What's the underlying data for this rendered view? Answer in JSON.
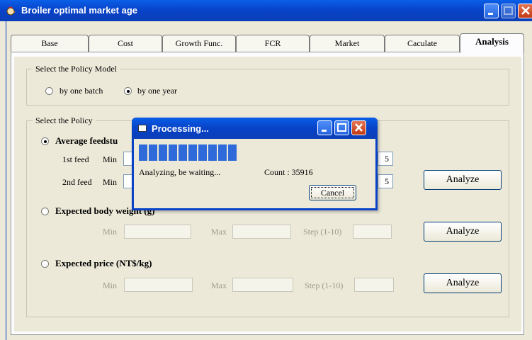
{
  "window": {
    "title": "Broiler optimal market age",
    "icon": "rooster-icon"
  },
  "tabs": [
    "Base",
    "Cost",
    "Growth Func.",
    "FCR",
    "Market",
    "Caculate",
    "Analysis"
  ],
  "active_tab": "Analysis",
  "policy_model": {
    "legend": "Select the Policy Model",
    "options": [
      "by one batch",
      "by one year"
    ],
    "selected": "by one year"
  },
  "policy": {
    "legend": "Select the Policy",
    "feed": {
      "label": "Average feedstu",
      "row1_label": "1st feed",
      "row2_label": "2nd feed",
      "min_label": "Min",
      "step_value_1": "5",
      "step_value_2": "5",
      "analyze": "Analyze"
    },
    "weight": {
      "label": "Expected body weight (g)",
      "min_label": "Min",
      "max_label": "Max",
      "step_label": "Step (1-10)",
      "analyze": "Analyze"
    },
    "price": {
      "label": "Expected price (NT$/kg)",
      "min_label": "Min",
      "max_label": "Max",
      "step_label": "Step (1-10)",
      "analyze": "Analyze"
    }
  },
  "dialog": {
    "title": "Processing...",
    "message": "Analyzing, be waiting...",
    "count_label": "Count : 35916",
    "cancel": "Cancel",
    "progress": 0.8
  },
  "colors": {
    "titlebar": "#0842c7",
    "progress": "#2e6ad9",
    "close": "#c23a14"
  }
}
